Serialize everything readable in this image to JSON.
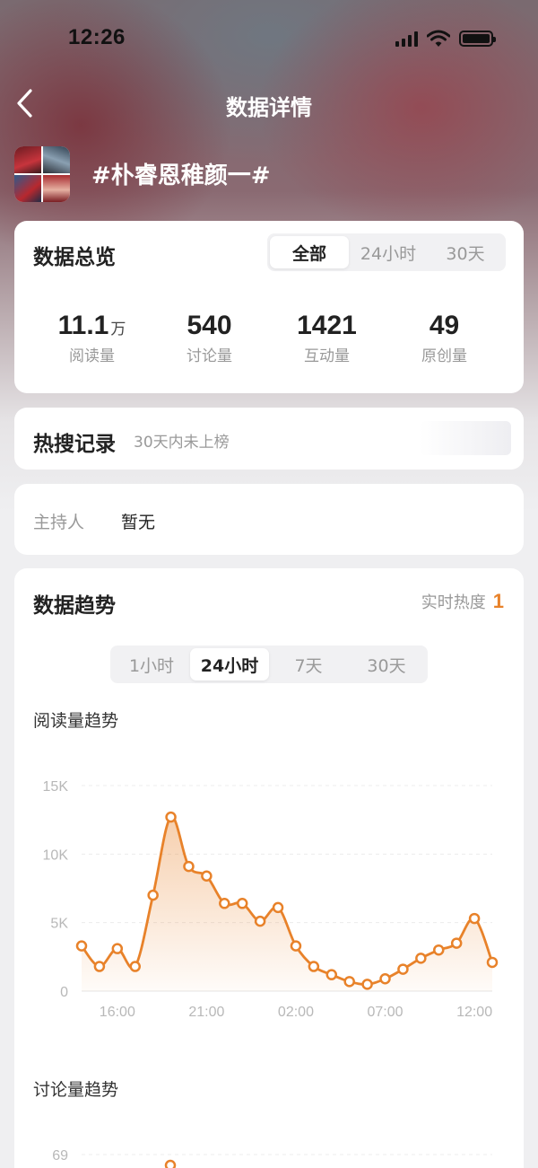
{
  "status_bar": {
    "time": "12:26"
  },
  "nav": {
    "title": "数据详情"
  },
  "topic": {
    "title": "#朴睿恩稚颜一#"
  },
  "overview": {
    "title": "数据总览",
    "tabs": [
      "全部",
      "24小时",
      "30天"
    ],
    "active_tab": "全部",
    "stats": [
      {
        "value": "11.1",
        "unit": "万",
        "label": "阅读量"
      },
      {
        "value": "540",
        "unit": "",
        "label": "讨论量"
      },
      {
        "value": "1421",
        "unit": "",
        "label": "互动量"
      },
      {
        "value": "49",
        "unit": "",
        "label": "原创量"
      }
    ]
  },
  "hot_search": {
    "title": "热搜记录",
    "note": "30天内未上榜"
  },
  "host": {
    "label": "主持人",
    "value": "暂无"
  },
  "trend": {
    "title": "数据趋势",
    "realtime_label": "实时热度",
    "realtime_value": "1",
    "tabs": [
      "1小时",
      "24小时",
      "7天",
      "30天"
    ],
    "active_tab": "24小时",
    "read_title": "阅读量趋势",
    "discuss_title": "讨论量趋势",
    "discuss_first_tick": "69"
  },
  "colors": {
    "accent": "#e8822a",
    "accent_fill": "#fbe3cf"
  },
  "chart_data": {
    "type": "area",
    "title": "阅读量趋势",
    "x": [
      "14:00",
      "15:00",
      "16:00",
      "17:00",
      "18:00",
      "19:00",
      "20:00",
      "21:00",
      "22:00",
      "23:00",
      "00:00",
      "01:00",
      "02:00",
      "03:00",
      "04:00",
      "05:00",
      "06:00",
      "07:00",
      "08:00",
      "09:00",
      "10:00",
      "11:00",
      "12:00",
      "13:00"
    ],
    "x_ticks": [
      "16:00",
      "21:00",
      "02:00",
      "07:00",
      "12:00"
    ],
    "y_ticks": [
      "0",
      "5K",
      "10K",
      "15K"
    ],
    "ylim": [
      0,
      15000
    ],
    "series": [
      {
        "values": [
          3300,
          1800,
          3100,
          1800,
          7000,
          12700,
          9100,
          8400,
          6400,
          6400,
          5100,
          6100,
          3300,
          1800,
          1200,
          700,
          500,
          900,
          1600,
          2400,
          3000,
          3500,
          5300,
          2100
        ]
      }
    ],
    "grid": true
  }
}
